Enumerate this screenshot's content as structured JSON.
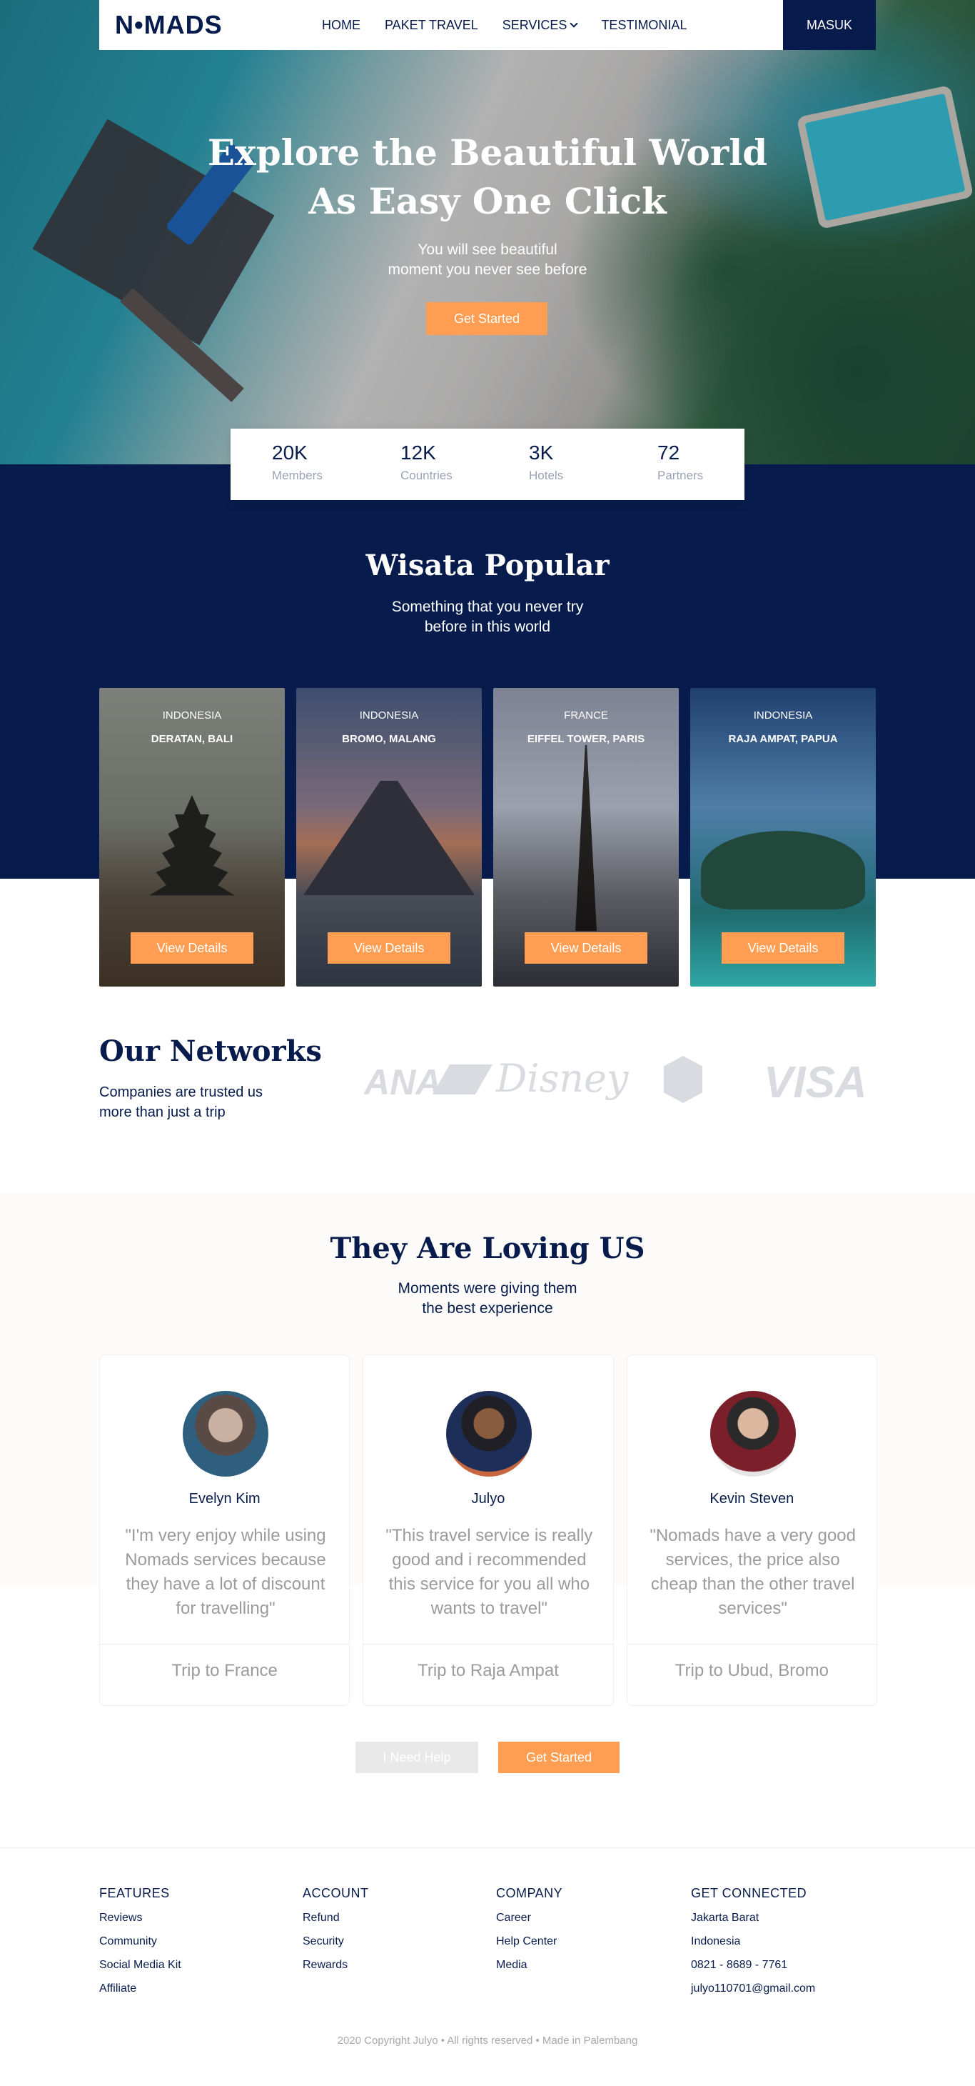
{
  "nav": {
    "logo": "N•MADS",
    "items": [
      "HOME",
      "PAKET TRAVEL",
      "SERVICES",
      "TESTIMONIAL"
    ],
    "login": "MASUK"
  },
  "hero": {
    "title_line1": "Explore the Beautiful World",
    "title_line2": "As Easy One Click",
    "sub_line1": "You will see beautiful",
    "sub_line2": "moment you never see before",
    "cta": "Get Started"
  },
  "stats": [
    {
      "value": "20K",
      "label": "Members"
    },
    {
      "value": "12K",
      "label": "Countries"
    },
    {
      "value": "3K",
      "label": "Hotels"
    },
    {
      "value": "72",
      "label": "Partners"
    }
  ],
  "popular": {
    "title": "Wisata Popular",
    "sub_line1": "Something that you never try",
    "sub_line2": "before in this world",
    "cards": [
      {
        "country": "INDONESIA",
        "place": "DERATAN, BALI",
        "button": "View Details"
      },
      {
        "country": "INDONESIA",
        "place": "BROMO, MALANG",
        "button": "View Details"
      },
      {
        "country": "FRANCE",
        "place": "EIFFEL TOWER, PARIS",
        "button": "View Details"
      },
      {
        "country": "INDONESIA",
        "place": "RAJA AMPAT, PAPUA",
        "button": "View Details"
      }
    ]
  },
  "networks": {
    "title": "Our Networks",
    "sub_line1": "Companies are trusted us",
    "sub_line2": "more than just a trip",
    "logos": [
      "ANA",
      "Disney",
      "Starbucks-icon",
      "VISA"
    ]
  },
  "testimonials": {
    "title": "They Are Loving US",
    "sub_line1": "Moments were giving them",
    "sub_line2": "the best experience",
    "items": [
      {
        "name": "Evelyn Kim",
        "quote": "\"I'm very enjoy while using Nomads services because they have a lot of discount for travelling\"",
        "trip": "Trip to France"
      },
      {
        "name": "Julyo",
        "quote": "\"This travel service is really good and i recommended this service for you all who wants to travel\"",
        "trip": "Trip to Raja Ampat"
      },
      {
        "name": "Kevin Steven",
        "quote": "\"Nomads have a very good services, the price also cheap than the other travel services\"",
        "trip": "Trip to Ubud, Bromo"
      }
    ],
    "help_button": "I Need Help",
    "start_button": "Get Started"
  },
  "footer": {
    "columns": [
      {
        "title": "FEATURES",
        "items": [
          "Reviews",
          "Community",
          "Social Media Kit",
          "Affiliate"
        ]
      },
      {
        "title": "ACCOUNT",
        "items": [
          "Refund",
          "Security",
          "Rewards"
        ]
      },
      {
        "title": "COMPANY",
        "items": [
          "Career",
          "Help Center",
          "Media"
        ]
      },
      {
        "title": "GET CONNECTED",
        "items": [
          "Jakarta Barat",
          "Indonesia",
          "0821 - 8689 - 7761",
          "julyo110701@gmail.com"
        ]
      }
    ],
    "copyright": "2020 Copyright Julyo • All rights reserved • Made in Palembang"
  },
  "colors": {
    "primary": "#071C4D",
    "accent": "#FF9E53"
  }
}
